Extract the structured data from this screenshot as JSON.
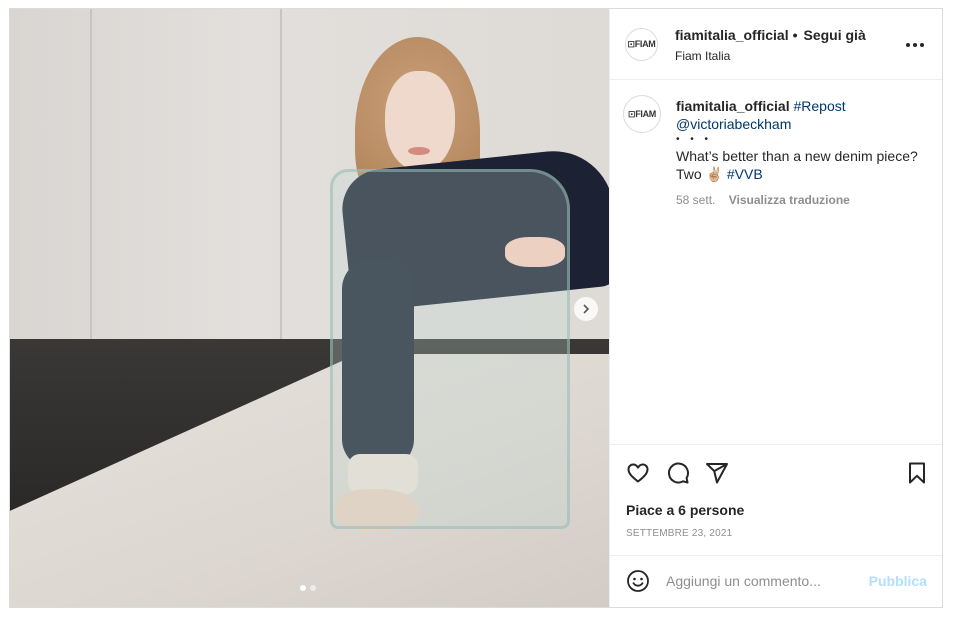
{
  "post": {
    "username": "fiamitalia_official",
    "separator": "•",
    "follow_label": "Segui già",
    "location": "Fiam Italia",
    "avatar_text": "⊡FIAM",
    "more_label": "•••",
    "carousel": {
      "current": 1,
      "total": 2
    }
  },
  "caption": {
    "username": "fiamitalia_official",
    "repost_tag": "#Repost",
    "mention": "@victoriabeckham",
    "bullets": "• • •",
    "text": "What’s better than a new denim piece? Two ✌🏼",
    "hashtag": "#VVB",
    "time": "58 sett.",
    "translate_label": "Visualizza traduzione"
  },
  "actions": {
    "likes": "Piace a 6 persone",
    "date": "SETTEMBRE 23, 2021"
  },
  "comment": {
    "placeholder": "Aggiungi un commento...",
    "publish_label": "Pubblica"
  },
  "colors": {
    "link": "#00376b",
    "publish_disabled": "#b2dffc",
    "muted": "#8e8e8e",
    "border": "#dbdbdb"
  },
  "icons": {
    "more": "more-horizontal-icon",
    "like": "heart-icon",
    "comment": "comment-bubble-icon",
    "share": "paper-plane-icon",
    "save": "bookmark-icon",
    "emoji": "smiley-icon",
    "next": "chevron-right-icon"
  }
}
